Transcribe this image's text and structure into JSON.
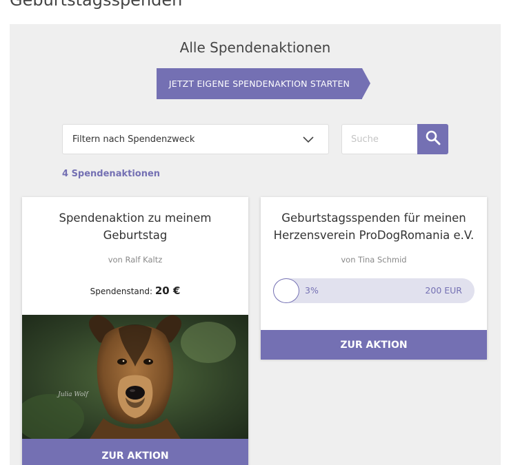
{
  "page": {
    "title": "Geburtstagsspenden"
  },
  "panel": {
    "title": "Alle Spendenaktionen",
    "cta_label": "JETZT EIGENE SPENDENAKTION STARTEN",
    "filter": {
      "selected": "Filtern nach Spendenzweck",
      "icon": "chevron-down-icon"
    },
    "search": {
      "placeholder": "Suche",
      "value": "",
      "icon": "search-icon"
    },
    "count_label": "4 Spendenaktionen"
  },
  "cards": [
    {
      "title": "Spendenaktion zu meinem Geburtstag",
      "author": "von Ralf Kaltz",
      "amount_label": "Spendenstand:",
      "amount_value": "20 €",
      "image": "dog-portrait-photo",
      "button_label": "ZUR AKTION"
    },
    {
      "title_line1": "Geburtstagsspenden für meinen",
      "title_line2": "Herzensverein ProDogRomania e.V.",
      "author": "von Tina Schmid",
      "progress_percent_label": "3%",
      "progress_fraction": 0.03,
      "target_label": "200 EUR",
      "button_label": "ZUR AKTION"
    }
  ],
  "colors": {
    "accent": "#7470b3",
    "panel_bg": "#efefef",
    "progress_track": "#e1e1ee"
  }
}
